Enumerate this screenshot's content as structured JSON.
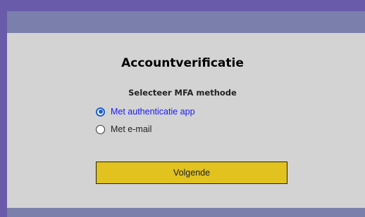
{
  "page": {
    "title": "Accountverificatie",
    "subtitle": "Selecteer MFA methode"
  },
  "mfa_options": [
    {
      "label": "Met authenticatie app",
      "selected": true
    },
    {
      "label": "Met e-mail",
      "selected": false
    }
  ],
  "actions": {
    "next_label": "Volgende"
  },
  "colors": {
    "background": "#6a5aaa",
    "card": "#d3d3d3",
    "bar": "#7b7fac",
    "accent": "#1a5fd6",
    "button": "#e1c21f"
  }
}
